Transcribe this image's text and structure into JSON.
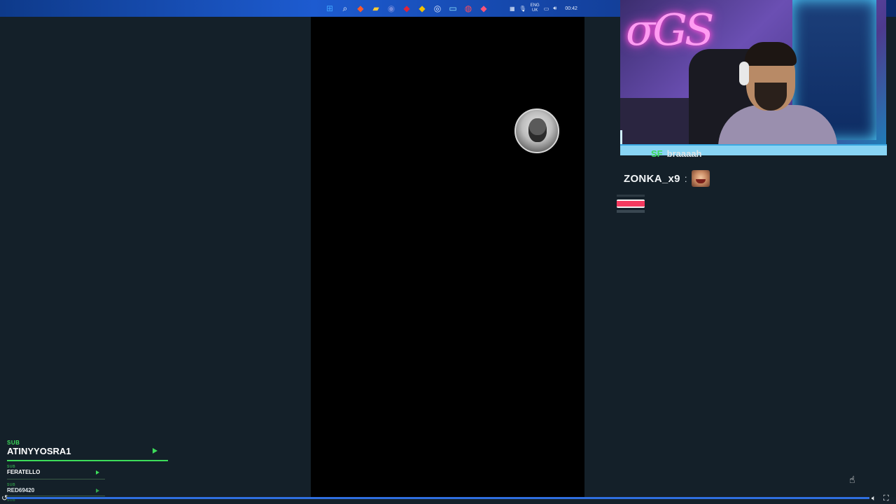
{
  "taskbar": {
    "icons": [
      {
        "name": "windows-start-icon",
        "glyph": "⊞",
        "color": "#3fa2ff"
      },
      {
        "name": "search-icon",
        "glyph": "⌕",
        "color": "#ffffff"
      },
      {
        "name": "brave-browser-icon",
        "glyph": "◆",
        "color": "#ff5a2b"
      },
      {
        "name": "file-explorer-icon",
        "glyph": "▰",
        "color": "#ffcc33"
      },
      {
        "name": "discord-icon",
        "glyph": "◉",
        "color": "#7289da"
      },
      {
        "name": "app-red-icon",
        "glyph": "◆",
        "color": "#e0243a"
      },
      {
        "name": "app-yellow-icon",
        "glyph": "◆",
        "color": "#f2c200"
      },
      {
        "name": "steam-icon",
        "glyph": "◎",
        "color": "#dfe9ff"
      },
      {
        "name": "terminal-icon",
        "glyph": "▭",
        "color": "#8fe6ff"
      },
      {
        "name": "app-circle-icon",
        "glyph": "◍",
        "color": "#ff4b5c"
      },
      {
        "name": "app-pin-icon",
        "glyph": "◆",
        "color": "#ff5478"
      }
    ],
    "tray": {
      "lang_top": "ENG",
      "lang_bottom": "UK",
      "clock": "00:42"
    }
  },
  "overlay": {
    "cut_name_prefix": "SF",
    "cut_name": "braaaah",
    "chat_user": "ZONKA_x9",
    "chat_colon": ":"
  },
  "subs": {
    "latest": {
      "tag": "SUB",
      "name": "ATINYYOSRA1"
    },
    "second": {
      "tag": "SUB",
      "name": "FERATELLO"
    },
    "third": {
      "tag": "SUB",
      "name": "RED69420"
    },
    "fourth": {
      "tag": "SUB"
    }
  },
  "colors": {
    "accent_green": "#3ddc5a",
    "panel_bg": "#142029",
    "progress_blue": "#2f6fe0"
  }
}
